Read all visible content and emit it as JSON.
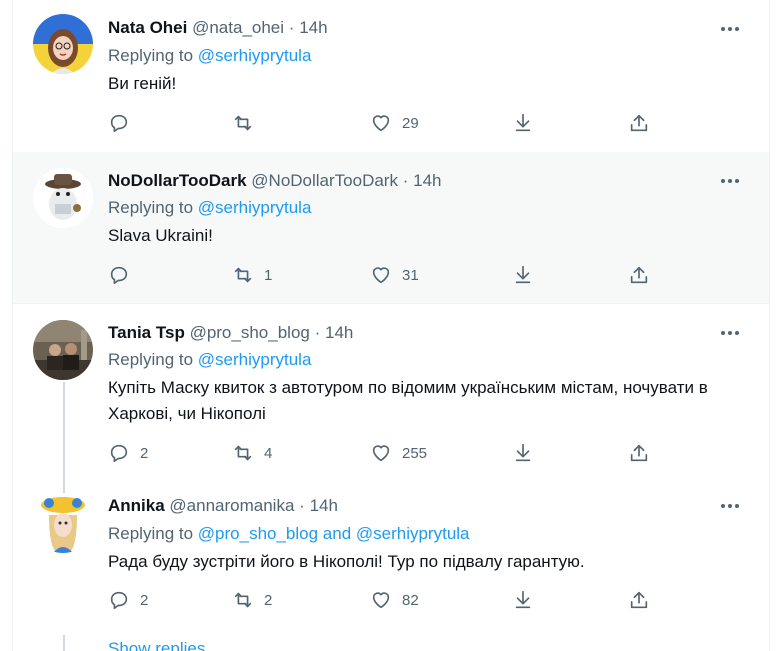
{
  "tweets": [
    {
      "name": "Nata Ohei",
      "handle": "@nata_ohei",
      "sep": "·",
      "time": "14h",
      "replying_prefix": "Replying to ",
      "replying_to": "@serhiyprytula",
      "text": "Ви геній!",
      "replies": "",
      "retweets": "",
      "likes": "29"
    },
    {
      "name": "NoDollarTooDark",
      "handle": "@NoDollarTooDark",
      "sep": "·",
      "time": "14h",
      "replying_prefix": "Replying to ",
      "replying_to": "@serhiyprytula",
      "text": "Slava Ukraini!",
      "replies": "",
      "retweets": "1",
      "likes": "31"
    },
    {
      "name": "Tania Tsp",
      "handle": "@pro_sho_blog",
      "sep": "·",
      "time": "14h",
      "replying_prefix": "Replying to ",
      "replying_to": "@serhiyprytula",
      "text": "Купіть Маску квиток з автотуром по відомим українським містам, ночувати в Харкові, чи Нікополі",
      "replies": "2",
      "retweets": "4",
      "likes": "255"
    },
    {
      "name": "Annika",
      "handle": "@annaromanika",
      "sep": "·",
      "time": "14h",
      "replying_prefix": "Replying to ",
      "replying_to": "@pro_sho_blog and @serhiyprytula",
      "text": "Рада буду зустріти його в Нікополі! Тур по підвалу гарантую.",
      "replies": "2",
      "retweets": "2",
      "likes": "82"
    }
  ],
  "show_replies": "Show replies",
  "colors": {
    "accent": "#1d9bf0",
    "secondary_text": "#536471",
    "highlight_bg": "#f7f9f9",
    "thread_line": "#cfd9de"
  },
  "icons": {
    "reply": "reply-icon",
    "retweet": "retweet-icon",
    "like": "heart-icon",
    "download": "download-icon",
    "share": "share-icon",
    "more": "more-icon"
  }
}
